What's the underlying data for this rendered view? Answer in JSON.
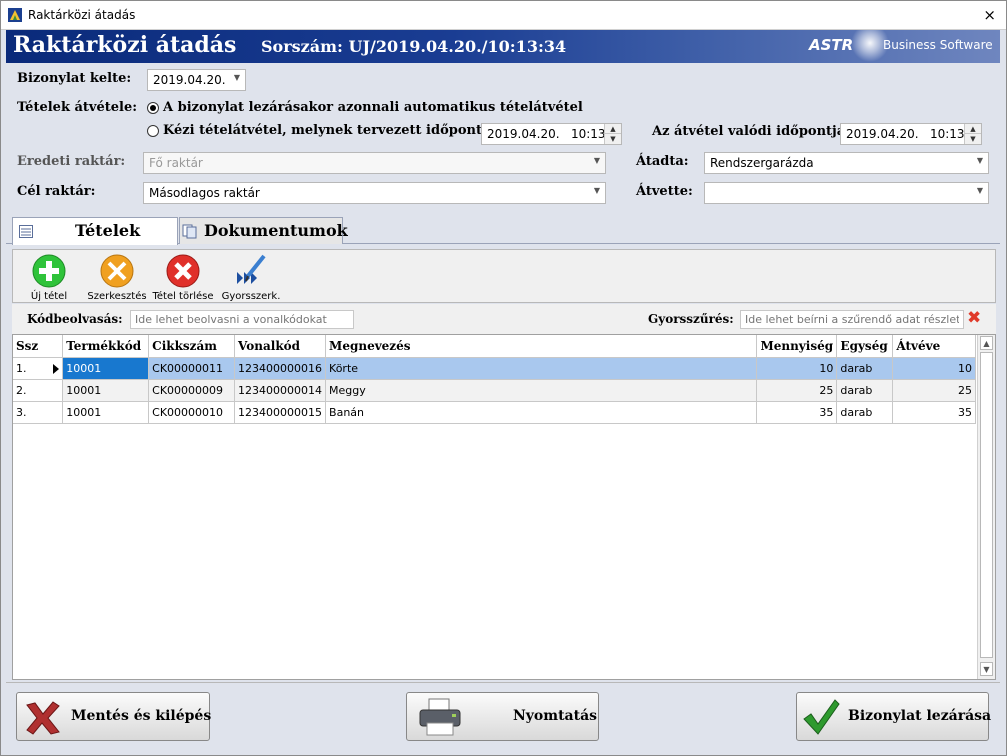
{
  "window": {
    "title": "Raktárközi átadás",
    "close_glyph": "×"
  },
  "banner": {
    "heading": "Raktárközi átadás",
    "serial": "Sorszám: UJ/2019.04.20./10:13:34",
    "brand_name": "ASTR",
    "brand_suffix": "Business Software"
  },
  "form": {
    "doc_date_label": "Bizonylat kelte:",
    "doc_date_value": "2019.04.20.",
    "receipt_label": "Tételek átvétele:",
    "radio_auto_label": "A bizonylat lezárásakor azonnali automatikus tételátvétel",
    "radio_manual_label": "Kézi tételátvétel, melynek tervezett időpontja:",
    "planned_datetime": "2019.04.20.   10:13",
    "actual_time_label": "Az átvétel valódi időpontja:",
    "actual_datetime": "2019.04.20.   10:13",
    "source_wh_label": "Eredeti raktár:",
    "source_wh_value": "Fő raktár",
    "target_wh_label": "Cél raktár:",
    "target_wh_value": "Másodlagos raktár",
    "handed_over_label": "Átadta:",
    "handed_over_value": "Rendszergarázda",
    "received_label": "Átvette:",
    "received_value": ""
  },
  "tabs": [
    {
      "label": "Tételek"
    },
    {
      "label": "Dokumentumok"
    }
  ],
  "toolbar": {
    "new_item": "Új tétel",
    "edit": "Szerkesztés",
    "delete_item": "Tétel törlése",
    "quick_edit": "Gyorsszerk."
  },
  "scan": {
    "label": "Kódbeolvasás:",
    "placeholder": "Ide lehet beolvasni a vonalkódokat",
    "filter_label": "Gyorsszűrés:",
    "filter_placeholder": "Ide lehet beírni a szűrendő adat részletet"
  },
  "grid": {
    "columns": [
      "Ssz",
      "Termékkód",
      "Cikkszám",
      "Vonalkód",
      "Megnevezés",
      "Mennyiség",
      "Egység",
      "Átvéve"
    ],
    "rows": [
      {
        "ssz": "1.",
        "termekkod": "10001",
        "cikkszam": "CK00000011",
        "vonalkod": "123400000016",
        "megnevezes": "Körte",
        "mennyiseg": "10",
        "egyseg": "darab",
        "atveve": "10"
      },
      {
        "ssz": "2.",
        "termekkod": "10001",
        "cikkszam": "CK00000009",
        "vonalkod": "123400000014",
        "megnevezes": "Meggy",
        "mennyiseg": "25",
        "egyseg": "darab",
        "atveve": "25"
      },
      {
        "ssz": "3.",
        "termekkod": "10001",
        "cikkszam": "CK00000010",
        "vonalkod": "123400000015",
        "megnevezes": "Banán",
        "mennyiseg": "35",
        "egyseg": "darab",
        "atveve": "35"
      }
    ]
  },
  "footer": {
    "save_exit": "Mentés és kilépés",
    "print": "Nyomtatás",
    "close_doc": "Bizonylat lezárása"
  },
  "colors": {
    "selected_row": "#a9c8ee",
    "focused_cell": "#1878cf",
    "banner_dark": "#0a2a7a",
    "new_green": "#2fc33a",
    "edit_orange": "#f0a020",
    "delete_red": "#e0302a"
  }
}
